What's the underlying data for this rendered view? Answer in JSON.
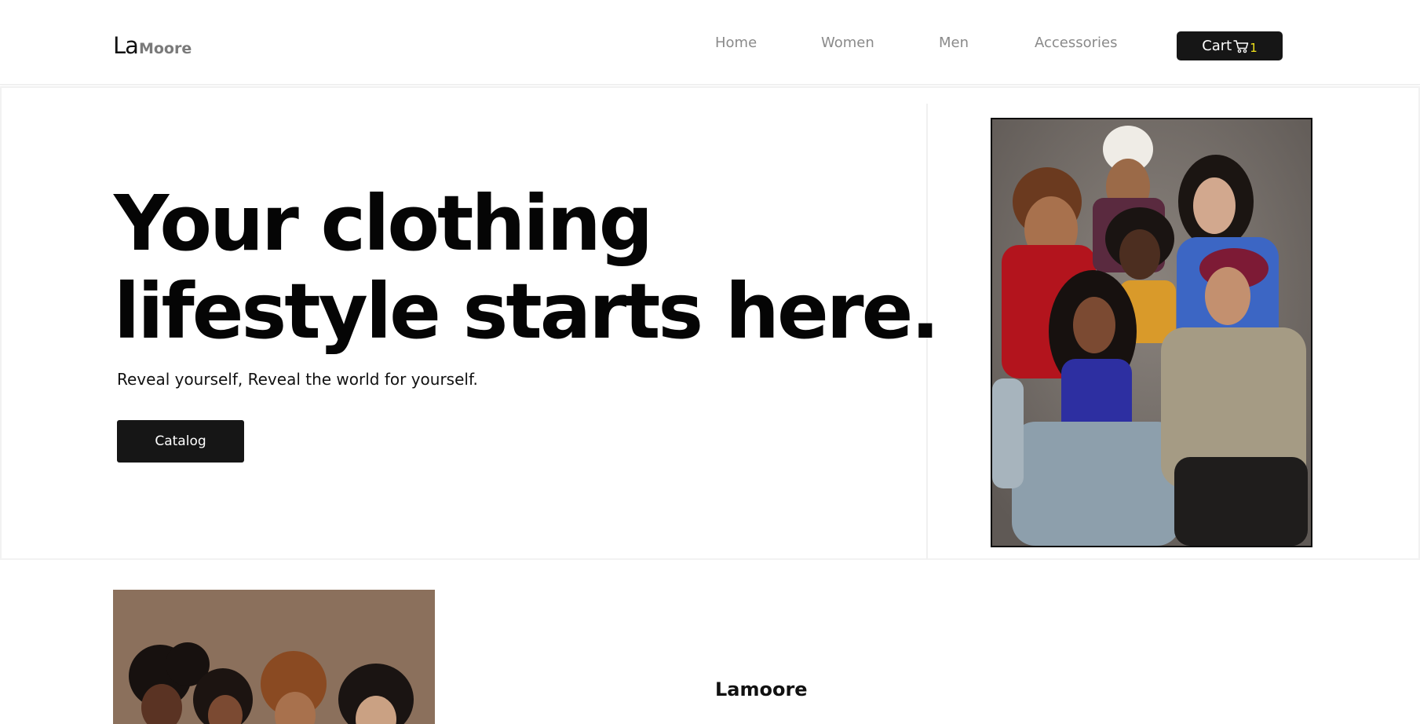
{
  "header": {
    "logo_primary": "La",
    "logo_secondary": "Moore",
    "nav": [
      {
        "label": "Home"
      },
      {
        "label": "Women"
      },
      {
        "label": "Men"
      },
      {
        "label": "Accessories"
      }
    ],
    "cart_label": "Cart",
    "cart_count": "1",
    "cart_icon": "cart-icon"
  },
  "hero": {
    "title_line1": "Your clothing",
    "title_line2": "lifestyle starts here.",
    "subtitle": "Reveal yourself, Reveal the world for yourself.",
    "cta_label": "Catalog",
    "image": "group-portrait-photo"
  },
  "section": {
    "heading": "Lamoore",
    "image": "group-portrait-photo"
  },
  "colors": {
    "accent_dark": "#161616",
    "nav_text": "#8a8a8a",
    "badge": "#f2e31b",
    "photo_bg": "#77706b"
  }
}
